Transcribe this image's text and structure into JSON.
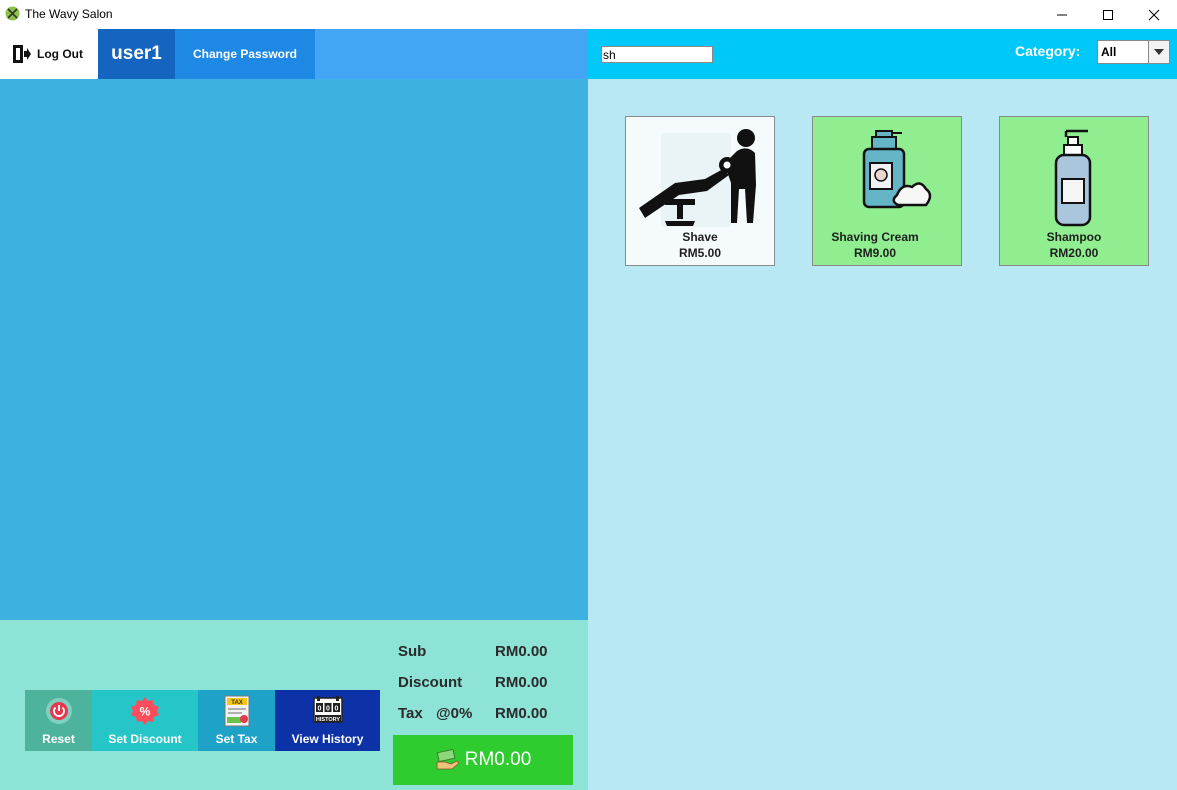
{
  "window": {
    "title": "The Wavy Salon",
    "icons": [
      "app-icon",
      "minimize-icon",
      "maximize-icon",
      "close-icon"
    ]
  },
  "header": {
    "logout_label": "Log Out",
    "username": "user1",
    "change_password_label": "Change Password"
  },
  "actions": {
    "reset_label": "Reset",
    "discount_label": "Set Discount",
    "tax_label": "Set Tax",
    "history_label": "View History"
  },
  "summary": {
    "sub_label": "Sub",
    "sub_value": "RM0.00",
    "discount_label": "Discount",
    "discount_value": "RM0.00",
    "tax_label": "Tax",
    "tax_rate": "@0%",
    "tax_value": "RM0.00",
    "total": "RM0.00"
  },
  "search": {
    "value": "sh"
  },
  "category": {
    "label": "Category:",
    "selected": "All"
  },
  "products": [
    {
      "name": "Shave",
      "price": "RM5.00",
      "icon": "barber-shave-icon"
    },
    {
      "name": "Shaving Cream",
      "price": "RM9.00",
      "icon": "shaving-cream-icon"
    },
    {
      "name": "Shampoo",
      "price": "RM20.00",
      "icon": "shampoo-bottle-icon"
    }
  ],
  "colors": {
    "header_blue": "#42a5f5",
    "user_blue": "#1565c0",
    "order_area": "#3db1e0",
    "bottom_panel": "#8de3d6",
    "right_header": "#00c8f8",
    "product_area": "#b8e8f4",
    "product_green": "#90ee90",
    "total_green": "#2fcc2f"
  }
}
